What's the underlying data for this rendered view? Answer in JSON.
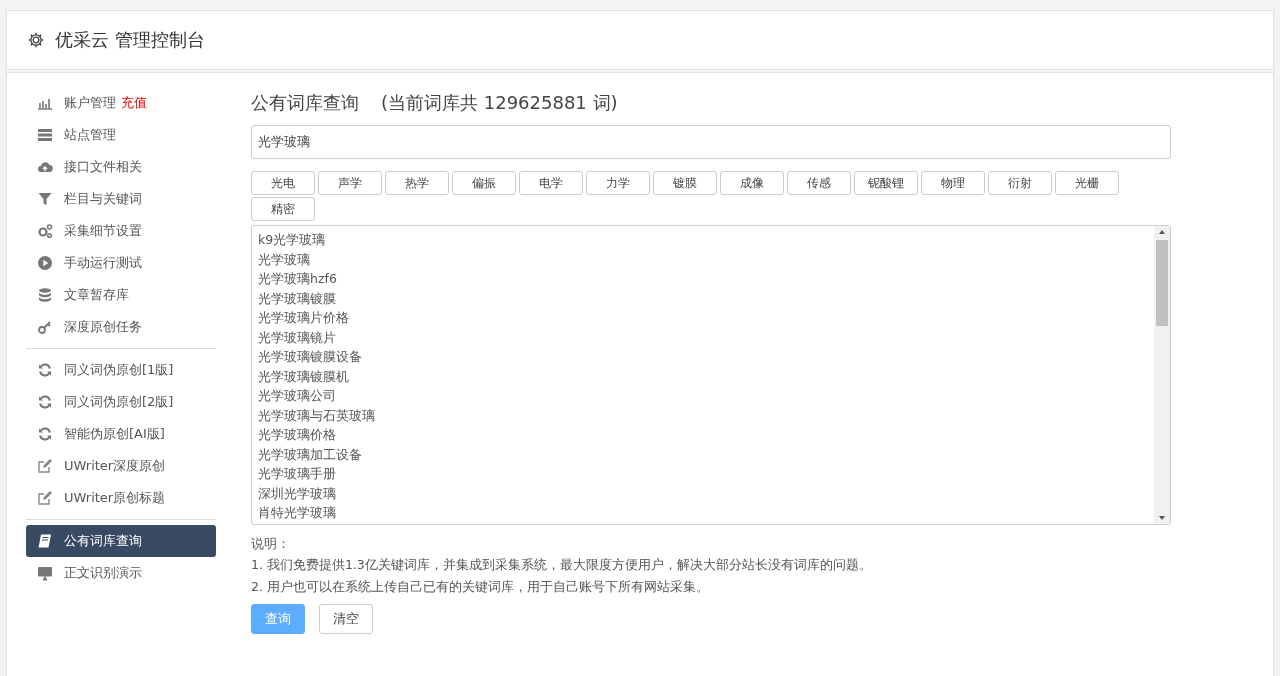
{
  "header": {
    "title": "优采云 管理控制台"
  },
  "sidebar": {
    "groups": [
      {
        "items": [
          {
            "label": "账户管理",
            "badge": "充值",
            "selected": false
          },
          {
            "label": "站点管理",
            "selected": false
          },
          {
            "label": "接口文件相关",
            "selected": false
          },
          {
            "label": "栏目与关键词",
            "selected": false
          },
          {
            "label": "采集细节设置",
            "selected": false
          },
          {
            "label": "手动运行测试",
            "selected": false
          },
          {
            "label": "文章暂存库",
            "selected": false
          },
          {
            "label": "深度原创任务",
            "selected": false
          }
        ]
      },
      {
        "items": [
          {
            "label": "同义词伪原创[1版]",
            "selected": false
          },
          {
            "label": "同义词伪原创[2版]",
            "selected": false
          },
          {
            "label": "智能伪原创[AI版]",
            "selected": false
          },
          {
            "label": "UWriter深度原创",
            "selected": false
          },
          {
            "label": "UWriter原创标题",
            "selected": false
          }
        ]
      },
      {
        "items": [
          {
            "label": "公有词库查询",
            "selected": true
          },
          {
            "label": "正文识别演示",
            "selected": false
          }
        ]
      }
    ]
  },
  "main": {
    "title": "公有词库查询",
    "count_note": "(当前词库共 129625881 词)",
    "search": {
      "value": "光学玻璃"
    },
    "tags": [
      "光电",
      "声学",
      "热学",
      "偏振",
      "电学",
      "力学",
      "镀膜",
      "成像",
      "传感",
      "铌酸锂",
      "物理",
      "衍射",
      "光栅",
      "精密"
    ],
    "results": [
      "k9光学玻璃",
      "光学玻璃",
      "光学玻璃hzf6",
      "光学玻璃镀膜",
      "光学玻璃片价格",
      "光学玻璃镜片",
      "光学玻璃镀膜设备",
      "光学玻璃镀膜机",
      "光学玻璃公司",
      "光学玻璃与石英玻璃",
      "光学玻璃价格",
      "光学玻璃加工设备",
      "光学玻璃手册",
      "深圳光学玻璃",
      "肖特光学玻璃"
    ],
    "notes_title": "说明：",
    "notes": [
      "1. 我们免费提供1.3亿关键词库，并集成到采集系统，最大限度方便用户，解决大部分站长没有词库的问题。",
      "2. 用户也可以在系统上传自己已有的关键词库，用于自己账号下所有网站采集。"
    ],
    "buttons": [
      {
        "label": "查询",
        "kind": "primary"
      },
      {
        "label": "清空",
        "kind": "default"
      }
    ]
  }
}
